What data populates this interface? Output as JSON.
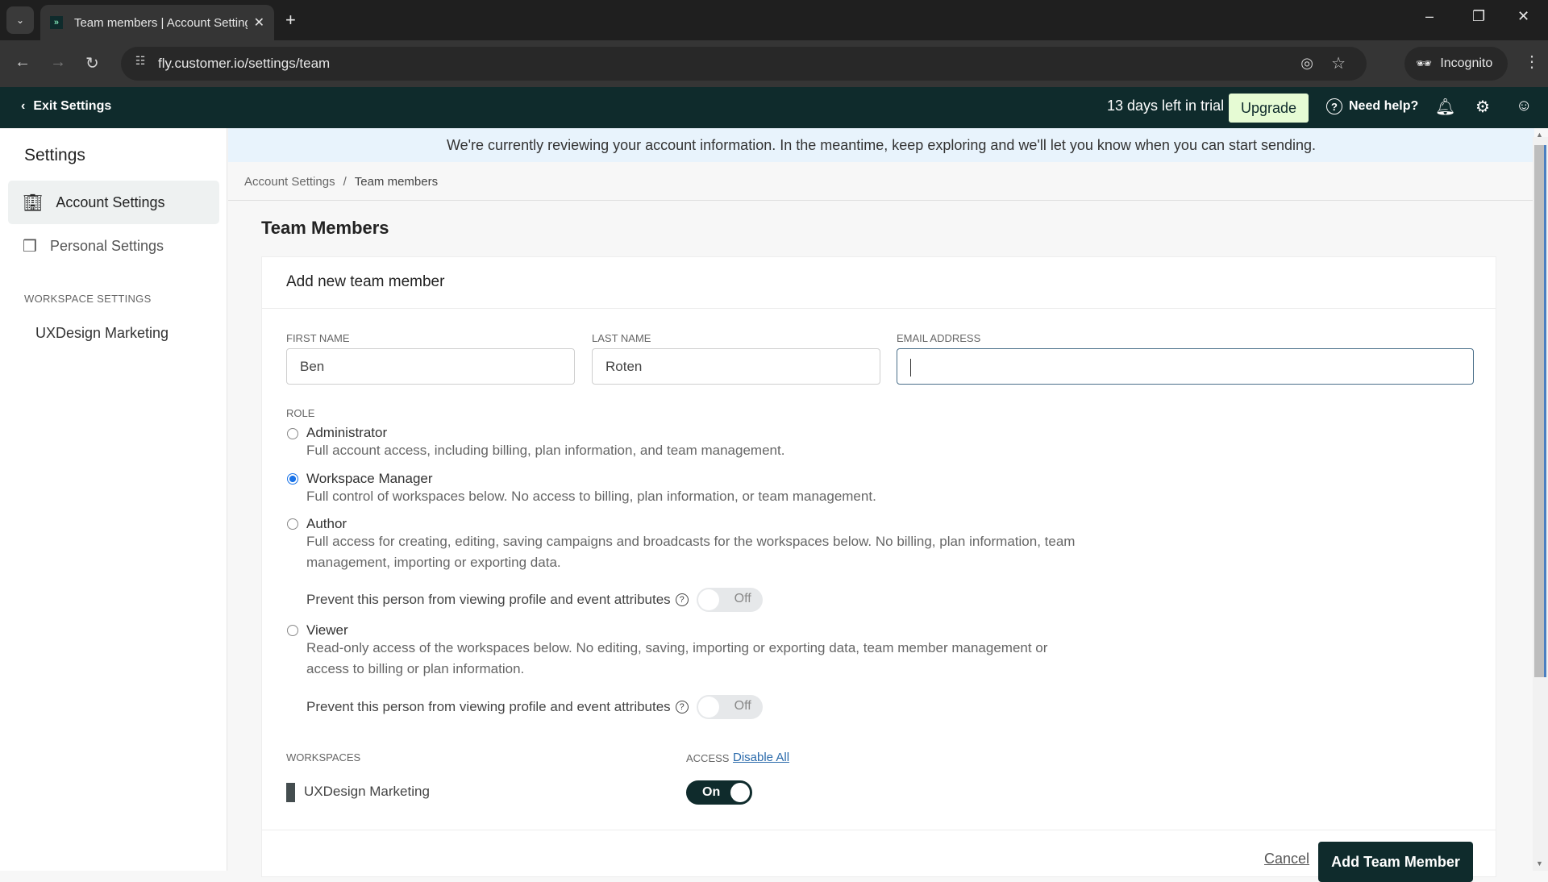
{
  "browser": {
    "tab_title": "Team members | Account Settings",
    "url": "fly.customer.io/settings/team",
    "incognito_label": "Incognito"
  },
  "header": {
    "exit_label": "Exit Settings",
    "trial_text": "13 days left in trial",
    "upgrade_label": "Upgrade",
    "help_label": "Need help?"
  },
  "sidebar": {
    "title": "Settings",
    "items": [
      {
        "label": "Account Settings",
        "icon": "building-icon",
        "active": true
      },
      {
        "label": "Personal Settings",
        "icon": "cards-icon",
        "active": false
      }
    ],
    "section_label": "WORKSPACE SETTINGS",
    "workspace": "UXDesign Marketing"
  },
  "banner": {
    "text": "We're currently reviewing your account information. In the meantime, keep exploring and we'll let you know when you can start sending."
  },
  "breadcrumb": {
    "parent": "Account Settings",
    "separator": "/",
    "current": "Team members"
  },
  "page": {
    "title": "Team Members"
  },
  "form": {
    "title": "Add new team member",
    "first_name": {
      "label": "FIRST NAME",
      "value": "Ben"
    },
    "last_name": {
      "label": "LAST NAME",
      "value": "Roten"
    },
    "email": {
      "label": "EMAIL ADDRESS",
      "value": ""
    },
    "role_label": "ROLE",
    "roles": [
      {
        "name": "Administrator",
        "desc": "Full account access, including billing, plan information, and team management.",
        "checked": false
      },
      {
        "name": "Workspace Manager",
        "desc": "Full control of workspaces below. No access to billing, plan information, or team management.",
        "checked": true
      },
      {
        "name": "Author",
        "desc": "Full access for creating, editing, saving campaigns and broadcasts for the workspaces below. No billing, plan information, team management, importing or exporting data.",
        "checked": false
      },
      {
        "name": "Viewer",
        "desc": "Read-only access of the workspaces below. No editing, saving, importing or exporting data, team member management or access to billing or plan information.",
        "checked": false
      }
    ],
    "prevent_label": "Prevent this person from viewing profile and event attributes",
    "toggle_off_label": "Off",
    "workspaces_label": "WORKSPACES",
    "access_label": "ACCESS",
    "disable_all_label": "Disable All",
    "workspace_rows": [
      {
        "name": "UXDesign Marketing",
        "access": "On"
      }
    ],
    "cancel_label": "Cancel",
    "submit_label": "Add Team Member"
  }
}
